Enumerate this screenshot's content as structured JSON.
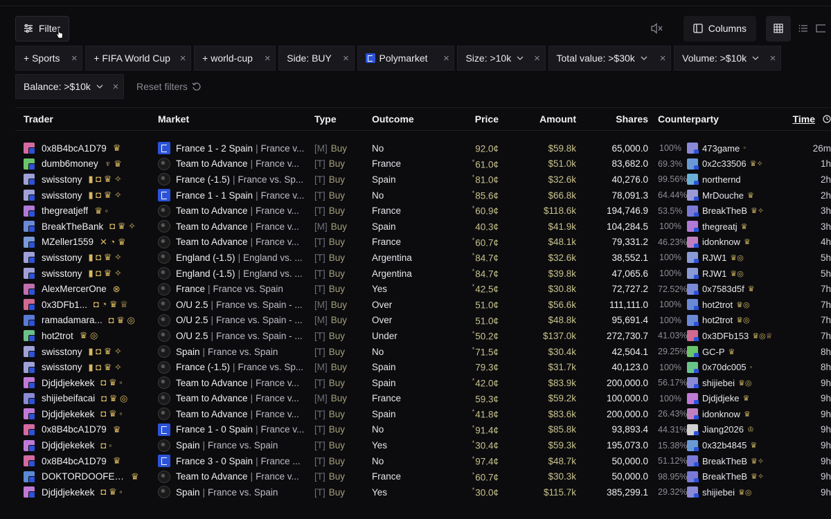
{
  "toolbar": {
    "filter_label": "Filter",
    "columns_label": "Columns"
  },
  "chips": [
    {
      "label": "+ Sports"
    },
    {
      "label": "+ FIFA World Cup"
    },
    {
      "label": "+ world-cup"
    },
    {
      "label": "Side: BUY"
    },
    {
      "label": "Polymarket"
    },
    {
      "label": "Size: >10k"
    },
    {
      "label": "Total value: >$30k"
    },
    {
      "label": "Volume: >$10k"
    },
    {
      "label": "Balance: >$10k"
    }
  ],
  "reset_label": "Reset filters",
  "columns": {
    "trader": "Trader",
    "market": "Market",
    "type": "Type",
    "outcome": "Outcome",
    "price": "Price",
    "amount": "Amount",
    "shares": "Shares",
    "counterparty": "Counterparty",
    "time": "Time"
  },
  "rows": [
    {
      "trader": "0x8B4bcA1D79",
      "tcolor": "#d46aa0",
      "badges": "♛",
      "mk": "poly",
      "title": "France 1 - 2 Spain",
      "event": "France v...",
      "tag": "[M]",
      "side": "Buy",
      "outcome": "No",
      "pmark": "",
      "price": "92.0¢",
      "amount": "$59.8k",
      "shares": "65,000.0",
      "pct": "100%",
      "cpcolor": "#8a8ad6",
      "cp": "473game",
      "cpb": "◦",
      "time": "26m"
    },
    {
      "trader": "dumb6money",
      "tcolor": "#6ac46a",
      "badges": "♆ ♛",
      "mk": "ball",
      "title": "Team to Advance",
      "event": "France v...",
      "tag": "[T]",
      "side": "Buy",
      "outcome": "France",
      "pmark": "*",
      "price": "61.0¢",
      "amount": "$51.0k",
      "shares": "83,682.0",
      "pct": "69.3%",
      "cpcolor": "#6a9ad6",
      "cp": "0x2c33506",
      "cpb": "♛✧",
      "time": "1h"
    },
    {
      "trader": "swisstony",
      "tcolor": "#a0a0d8",
      "badges": "▮ ◘ ♛ ✧",
      "mk": "ball",
      "title": "France (-1.5)",
      "event": "France vs. Sp...",
      "tag": "[T]",
      "side": "Buy",
      "outcome": "Spain",
      "pmark": "*",
      "price": "81.0¢",
      "amount": "$32.6k",
      "shares": "40,276.0",
      "pct": "99.56%",
      "cpcolor": "#6ab0d6",
      "cp": "northernd",
      "cpb": "",
      "time": "2h"
    },
    {
      "trader": "swisstony",
      "tcolor": "#a0a0d8",
      "badges": "▮ ◘ ♛ ✧",
      "mk": "poly",
      "title": "France 1 - 1 Spain",
      "event": "France v...",
      "tag": "[T]",
      "side": "Buy",
      "outcome": "No",
      "pmark": "*",
      "price": "85.6¢",
      "amount": "$66.8k",
      "shares": "78,091.3",
      "pct": "64.44%",
      "cpcolor": "#9a9ad6",
      "cp": "MrDouche",
      "cpb": "♛",
      "time": "2h"
    },
    {
      "trader": "thegreatjeff",
      "tcolor": "#b07ad6",
      "badges": "♛ ◦",
      "mk": "ball",
      "title": "Team to Advance",
      "event": "France v...",
      "tag": "[T]",
      "side": "Buy",
      "outcome": "France",
      "pmark": "*",
      "price": "60.9¢",
      "amount": "$118.6k",
      "shares": "194,746.9",
      "pct": "53.5%",
      "cpcolor": "#7a7ad6",
      "cp": "BreakTheB",
      "cpb": "♛✧",
      "time": "3h"
    },
    {
      "trader": "BreakTheBank",
      "tcolor": "#6a8ad6",
      "badges": "◘ ♛ ✧",
      "mk": "ball",
      "title": "Team to Advance",
      "event": "France v...",
      "tag": "[M]",
      "side": "Buy",
      "outcome": "Spain",
      "pmark": "",
      "price": "40.3¢",
      "amount": "$41.9k",
      "shares": "104,284.5",
      "pct": "100%",
      "cpcolor": "#b07ad6",
      "cp": "thegreatj",
      "cpb": "♛",
      "time": "3h"
    },
    {
      "trader": "MZeller1559",
      "tcolor": "#7a9ad6",
      "badges": "✕ ◔ ♛",
      "mk": "ball",
      "title": "Team to Advance",
      "event": "France v...",
      "tag": "[T]",
      "side": "Buy",
      "outcome": "France",
      "pmark": "*",
      "price": "60.7¢",
      "amount": "$48.1k",
      "shares": "79,331.2",
      "pct": "46.23%",
      "cpcolor": "#c080c0",
      "cp": "idonknow",
      "cpb": "♛",
      "time": "4h"
    },
    {
      "trader": "swisstony",
      "tcolor": "#a0a0d8",
      "badges": "▮ ◘ ♛ ✧",
      "mk": "ball",
      "title": "England (-1.5)",
      "event": "England vs. ...",
      "tag": "[T]",
      "side": "Buy",
      "outcome": "Argentina",
      "pmark": "*",
      "price": "84.7¢",
      "amount": "$32.6k",
      "shares": "38,552.1",
      "pct": "100%",
      "cpcolor": "#8a9ad6",
      "cp": "RJW1",
      "cpb": "♛◎",
      "time": "5h"
    },
    {
      "trader": "swisstony",
      "tcolor": "#a0a0d8",
      "badges": "▮ ◘ ♛ ✧",
      "mk": "ball",
      "title": "England (-1.5)",
      "event": "England vs. ...",
      "tag": "[T]",
      "side": "Buy",
      "outcome": "Argentina",
      "pmark": "*",
      "price": "84.7¢",
      "amount": "$39.8k",
      "shares": "47,065.6",
      "pct": "100%",
      "cpcolor": "#8a9ad6",
      "cp": "RJW1",
      "cpb": "♛◎",
      "time": "5h"
    },
    {
      "trader": "AlexMercerOne",
      "tcolor": "#c070b0",
      "badges": "⊗",
      "mk": "ball",
      "title": "France",
      "event": "France vs. Spain",
      "tag": "[T]",
      "side": "Buy",
      "outcome": "Yes",
      "pmark": "*",
      "price": "42.5¢",
      "amount": "$30.8k",
      "shares": "72,727.2",
      "pct": "72.52%",
      "cpcolor": "#7a8ad6",
      "cp": "0x7583d5f",
      "cpb": "♛",
      "time": "7h"
    },
    {
      "trader": "0x3DFb1...",
      "tcolor": "#d06a90",
      "badges": "◘ ◔ ♛ ♕",
      "mk": "ball",
      "title": "O/U 2.5",
      "event": "France vs. Spain - ...",
      "tag": "[M]",
      "side": "Buy",
      "outcome": "Over",
      "pmark": "",
      "price": "51.0¢",
      "amount": "$56.6k",
      "shares": "111,111.0",
      "pct": "100%",
      "cpcolor": "#6a8ad6",
      "cp": "hot2trot",
      "cpb": "♛◎",
      "time": "7h"
    },
    {
      "trader": "ramadamara...",
      "tcolor": "#5a7ad6",
      "badges": "◘ ♛ ◎",
      "mk": "ball",
      "title": "O/U 2.5",
      "event": "France vs. Spain - ...",
      "tag": "[M]",
      "side": "Buy",
      "outcome": "Over",
      "pmark": "",
      "price": "51.0¢",
      "amount": "$48.8k",
      "shares": "95,691.4",
      "pct": "100%",
      "cpcolor": "#6a8ad6",
      "cp": "hot2trot",
      "cpb": "♛◎",
      "time": "7h"
    },
    {
      "trader": "hot2trot",
      "tcolor": "#6ac08a",
      "badges": "♛ ◎",
      "mk": "ball",
      "title": "O/U 2.5",
      "event": "France vs. Spain - ...",
      "tag": "[T]",
      "side": "Buy",
      "outcome": "Under",
      "pmark": "*",
      "price": "50.2¢",
      "amount": "$137.0k",
      "shares": "272,730.7",
      "pct": "41.03%",
      "cpcolor": "#d06a90",
      "cp": "0x3DFb153",
      "cpb": "♛◎♕",
      "time": "7h"
    },
    {
      "trader": "swisstony",
      "tcolor": "#a0a0d8",
      "badges": "▮ ◘ ♛ ✧",
      "mk": "ball",
      "title": "Spain",
      "event": "France vs. Spain",
      "tag": "[T]",
      "side": "Buy",
      "outcome": "No",
      "pmark": "*",
      "price": "71.5¢",
      "amount": "$30.4k",
      "shares": "42,504.1",
      "pct": "29.25%",
      "cpcolor": "#6ac46a",
      "cp": "GC-P",
      "cpb": "♛",
      "time": "8h"
    },
    {
      "trader": "swisstony",
      "tcolor": "#a0a0d8",
      "badges": "▮ ◘ ♛ ✧",
      "mk": "ball",
      "title": "France (-1.5)",
      "event": "France vs. Sp...",
      "tag": "[M]",
      "side": "Buy",
      "outcome": "Spain",
      "pmark": "",
      "price": "79.3¢",
      "amount": "$31.7k",
      "shares": "40,123.0",
      "pct": "100%",
      "cpcolor": "#6ac48a",
      "cp": "0x70dc005",
      "cpb": "◦",
      "time": "8h"
    },
    {
      "trader": "Djdjdjekekek",
      "tcolor": "#c07ad6",
      "badges": "◘ ♛ ◦",
      "mk": "ball",
      "title": "Team to Advance",
      "event": "France v...",
      "tag": "[T]",
      "side": "Buy",
      "outcome": "Spain",
      "pmark": "*",
      "price": "42.0¢",
      "amount": "$83.9k",
      "shares": "200,000.0",
      "pct": "56.17%",
      "cpcolor": "#8a8ad6",
      "cp": "shijiebei",
      "cpb": "♛◎",
      "time": "9h"
    },
    {
      "trader": "shijiebeifacai",
      "tcolor": "#8a8ad6",
      "badges": "◘ ♛ ◎",
      "mk": "ball",
      "title": "Team to Advance",
      "event": "France v...",
      "tag": "[M]",
      "side": "Buy",
      "outcome": "France",
      "pmark": "",
      "price": "59.3¢",
      "amount": "$59.2k",
      "shares": "100,000.0",
      "pct": "100%",
      "cpcolor": "#c07ad6",
      "cp": "Djdjdjeke",
      "cpb": "♛",
      "time": "9h"
    },
    {
      "trader": "Djdjdjekekek",
      "tcolor": "#c07ad6",
      "badges": "◘ ♛ ◦",
      "mk": "ball",
      "title": "Team to Advance",
      "event": "France v...",
      "tag": "[T]",
      "side": "Buy",
      "outcome": "Spain",
      "pmark": "*",
      "price": "41.8¢",
      "amount": "$83.6k",
      "shares": "200,000.0",
      "pct": "26.43%",
      "cpcolor": "#c080c0",
      "cp": "idonknow",
      "cpb": "♛",
      "time": "9h"
    },
    {
      "trader": "0x8B4bcA1D79",
      "tcolor": "#d46aa0",
      "badges": "♛",
      "mk": "poly",
      "title": "France 1 - 0 Spain",
      "event": "France v...",
      "tag": "[T]",
      "side": "Buy",
      "outcome": "No",
      "pmark": "*",
      "price": "91.4¢",
      "amount": "$85.8k",
      "shares": "93,893.4",
      "pct": "44.31%",
      "cpcolor": "#d0d0d0",
      "cp": "Jiang2026",
      "cpb": "♔",
      "time": "9h"
    },
    {
      "trader": "Djdjdjekekek",
      "tcolor": "#c07ad6",
      "badges": "◘ ◦",
      "mk": "ball",
      "title": "Spain",
      "event": "France vs. Spain",
      "tag": "[T]",
      "side": "Buy",
      "outcome": "Yes",
      "pmark": "*",
      "price": "30.4¢",
      "amount": "$59.3k",
      "shares": "195,073.0",
      "pct": "15.38%",
      "cpcolor": "#6a9ad6",
      "cp": "0x32b4845",
      "cpb": "♛",
      "time": "9h"
    },
    {
      "trader": "0x8B4bcA1D79",
      "tcolor": "#d46aa0",
      "badges": "♛",
      "mk": "poly",
      "title": "France 3 - 0 Spain",
      "event": "France ...",
      "tag": "[T]",
      "side": "Buy",
      "outcome": "No",
      "pmark": "*",
      "price": "97.4¢",
      "amount": "$48.7k",
      "shares": "50,000.0",
      "pct": "51.12%",
      "cpcolor": "#7a7ad6",
      "cp": "BreakTheB",
      "cpb": "♛✧",
      "time": "9h"
    },
    {
      "trader": "DOKTORDOOFENS...",
      "tcolor": "#5a8ad6",
      "badges": "♛",
      "mk": "ball",
      "title": "Team to Advance",
      "event": "France v...",
      "tag": "[T]",
      "side": "Buy",
      "outcome": "France",
      "pmark": "*",
      "price": "60.7¢",
      "amount": "$30.3k",
      "shares": "50,000.0",
      "pct": "98.95%",
      "cpcolor": "#7a7ad6",
      "cp": "BreakTheB",
      "cpb": "♛✧",
      "time": "9h"
    },
    {
      "trader": "Djdjdjekekek",
      "tcolor": "#c07ad6",
      "badges": "◘ ♛ ◦",
      "mk": "ball",
      "title": "Spain",
      "event": "France vs. Spain",
      "tag": "[T]",
      "side": "Buy",
      "outcome": "Yes",
      "pmark": "*",
      "price": "30.0¢",
      "amount": "$115.7k",
      "shares": "385,299.1",
      "pct": "29.32%",
      "cpcolor": "#8a8ad6",
      "cp": "shijiebei",
      "cpb": "♛◎",
      "time": "9h"
    }
  ]
}
